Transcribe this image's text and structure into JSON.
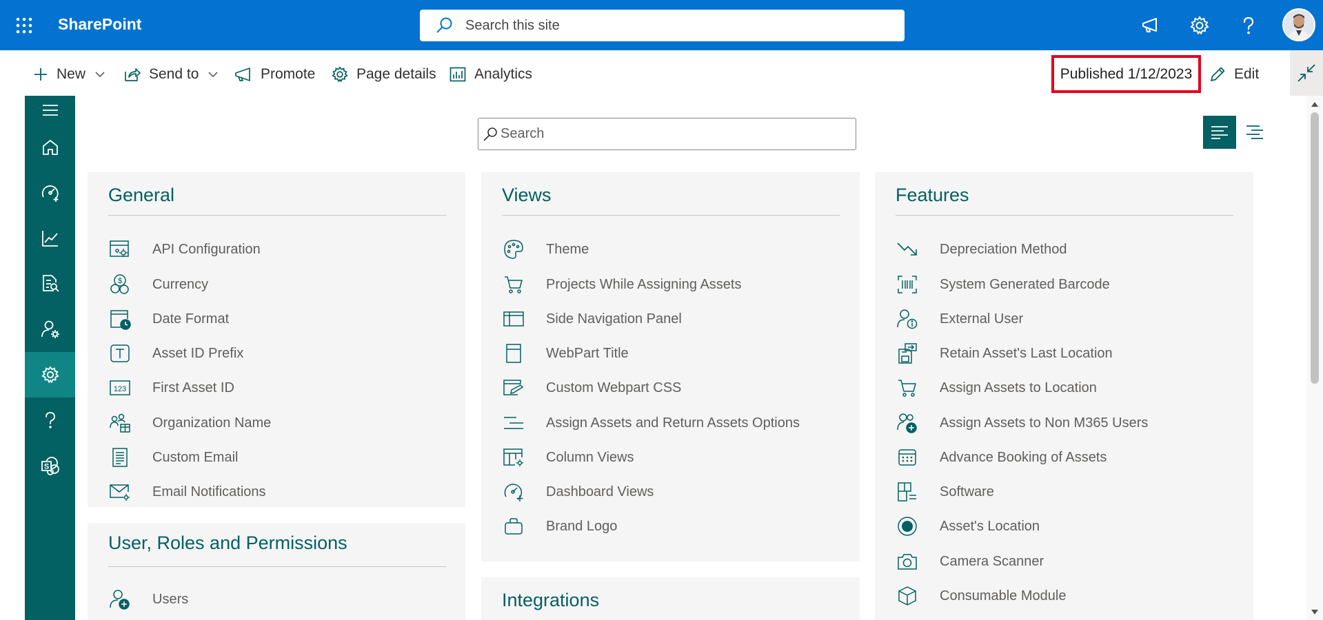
{
  "suite": {
    "brand": "SharePoint",
    "search_placeholder": "Search this site"
  },
  "commands": {
    "new_label": "New",
    "send_to_label": "Send to",
    "promote_label": "Promote",
    "page_details_label": "Page details",
    "analytics_label": "Analytics",
    "published_label": "Published 1/12/2023",
    "edit_label": "Edit"
  },
  "content": {
    "search_placeholder": "Search"
  },
  "colors": {
    "suite_blue": "#0372d1",
    "rail_teal": "#036063",
    "rail_active": "#0f8585",
    "highlight_red": "#e4001b"
  },
  "rail_icons": [
    "menu-icon",
    "home-icon",
    "dashboard-icon",
    "chart-icon",
    "report-icon",
    "user-settings-icon",
    "gear-icon",
    "help-icon",
    "sharepoint-icon"
  ],
  "sections": {
    "general": {
      "title": "General",
      "items": [
        {
          "label": "API Configuration",
          "icon": "api-config-icon"
        },
        {
          "label": "Currency",
          "icon": "currency-icon"
        },
        {
          "label": "Date Format",
          "icon": "date-format-icon"
        },
        {
          "label": "Asset ID Prefix",
          "icon": "text-prefix-icon"
        },
        {
          "label": "First Asset ID",
          "icon": "number-123-icon"
        },
        {
          "label": "Organization Name",
          "icon": "organization-icon"
        },
        {
          "label": "Custom Email",
          "icon": "document-icon"
        },
        {
          "label": "Email Notifications",
          "icon": "mail-settings-icon"
        }
      ]
    },
    "views": {
      "title": "Views",
      "items": [
        {
          "label": "Theme",
          "icon": "palette-icon"
        },
        {
          "label": "Projects While Assigning Assets",
          "icon": "cart-icon"
        },
        {
          "label": "Side Navigation Panel",
          "icon": "panel-icon"
        },
        {
          "label": "WebPart Title",
          "icon": "title-icon"
        },
        {
          "label": "Custom Webpart CSS",
          "icon": "edit-css-icon"
        },
        {
          "label": "Assign Assets and Return Assets Options",
          "icon": "options-lines-icon"
        },
        {
          "label": "Column Views",
          "icon": "column-settings-icon"
        },
        {
          "label": "Dashboard Views",
          "icon": "gauge-add-icon"
        },
        {
          "label": "Brand Logo",
          "icon": "briefcase-icon"
        }
      ]
    },
    "features": {
      "title": "Features",
      "items": [
        {
          "label": "Depreciation Method",
          "icon": "trend-down-icon"
        },
        {
          "label": "System Generated Barcode",
          "icon": "barcode-icon"
        },
        {
          "label": "External User",
          "icon": "user-info-icon"
        },
        {
          "label": "Retain Asset's Last Location",
          "icon": "save-transfer-icon"
        },
        {
          "label": "Assign Assets to Location",
          "icon": "cart-icon"
        },
        {
          "label": "Assign Assets to Non M365 Users",
          "icon": "users-add-icon"
        },
        {
          "label": "Advance Booking of Assets",
          "icon": "calendar-icon"
        },
        {
          "label": "Software",
          "icon": "software-grid-icon"
        },
        {
          "label": "Asset's Location",
          "icon": "radio-location-icon"
        },
        {
          "label": "Camera Scanner",
          "icon": "camera-icon"
        },
        {
          "label": "Consumable Module",
          "icon": "cube-icon"
        }
      ]
    },
    "users": {
      "title": "User, Roles and Permissions",
      "items": [
        {
          "label": "Users",
          "icon": "user-add-icon"
        }
      ]
    },
    "integrations": {
      "title": "Integrations"
    }
  }
}
